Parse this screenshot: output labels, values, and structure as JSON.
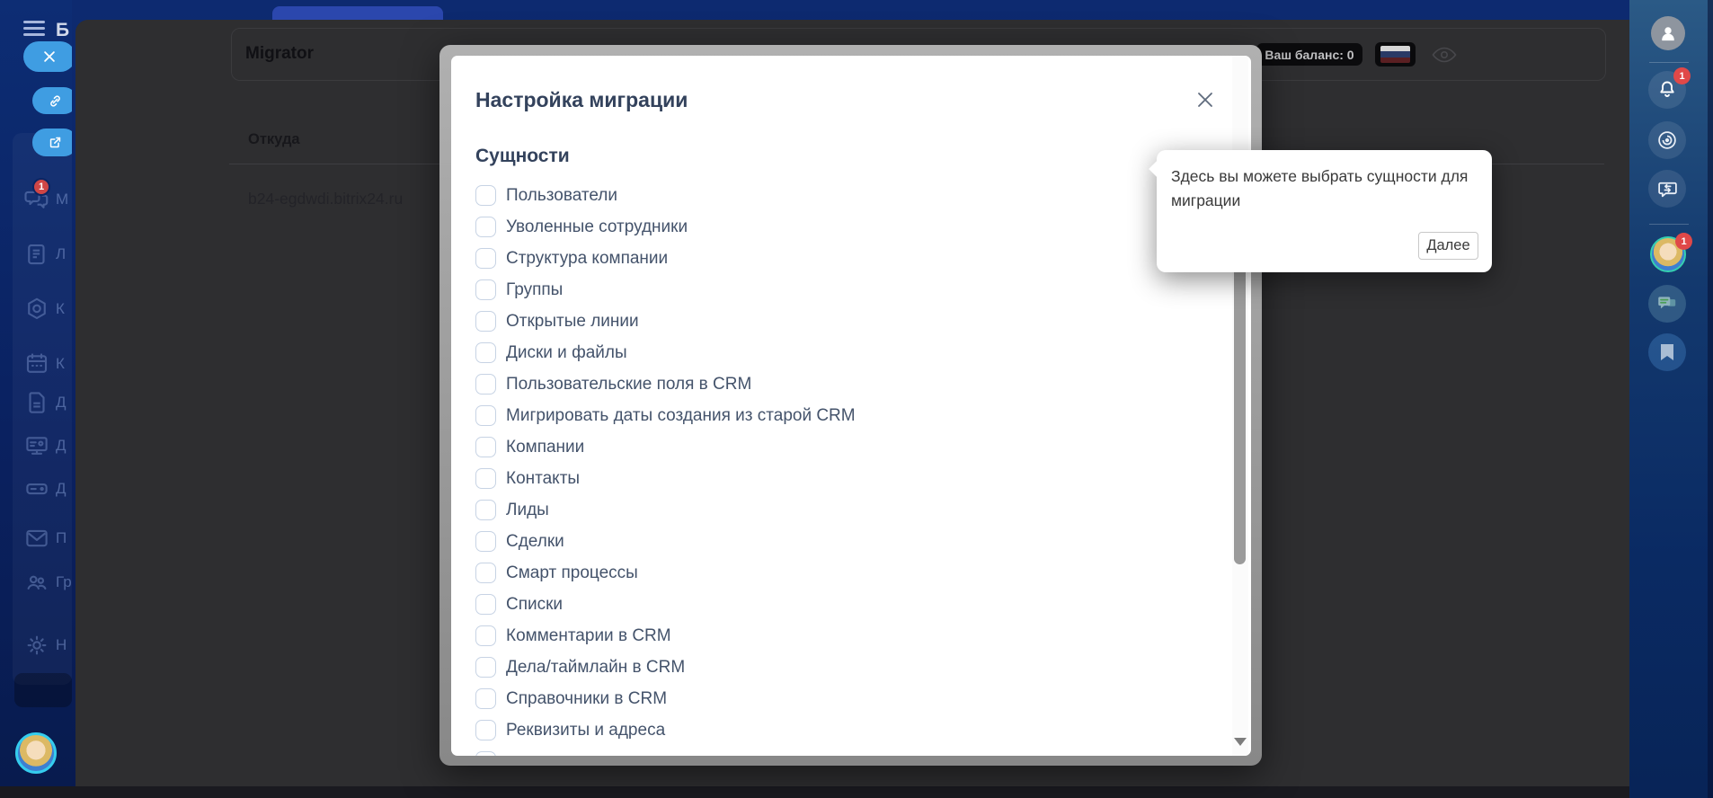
{
  "colors": {
    "accent_blue": "#3f9de2",
    "sidebar_navy": "#0a2363",
    "badge_red": "#e04848",
    "modal_title_text": "#33425c",
    "entity_label_text": "#44536b",
    "checkbox_border": "#c7d3e4",
    "overlay_dim": "#2e2e30"
  },
  "left_sidebar": {
    "hamburger_icon": "hamburger-icon",
    "logo_letter": "Б",
    "close_button_icon": "close-icon",
    "link_button_icon": "link-icon",
    "popout_button_icon": "external-link-icon",
    "menu": [
      {
        "icon": "messenger-icon",
        "label": "М",
        "badge": "1"
      },
      {
        "icon": "feed-icon",
        "label": "Л"
      },
      {
        "icon": "crm-icon",
        "label": "К"
      },
      {
        "icon": "calendar-icon",
        "label": "К"
      },
      {
        "icon": "docs-icon",
        "label": "Д"
      },
      {
        "icon": "boards-icon",
        "label": "Д"
      },
      {
        "icon": "drive-icon",
        "label": "Д"
      },
      {
        "icon": "mail-icon",
        "label": "П"
      },
      {
        "icon": "groups-icon",
        "label": "Гр"
      },
      {
        "icon": "settings-icon",
        "label": "Н"
      }
    ]
  },
  "workspace": {
    "app_title": "Migrator",
    "table": {
      "header": "Откуда",
      "rows": [
        "b24-egdwdi.bitrix24.ru"
      ]
    },
    "balance_badge": "Ваш баланс: 0",
    "flag_icon": "russia-flag-icon",
    "eye_icon": "eye-icon"
  },
  "modal": {
    "title": "Настройка миграции",
    "close_icon": "close-icon",
    "section_title": "Сущности",
    "entities": [
      {
        "label": "Пользователи",
        "checked": false
      },
      {
        "label": "Уволенные сотрудники",
        "checked": false
      },
      {
        "label": "Структура компании",
        "checked": false
      },
      {
        "label": "Группы",
        "checked": false
      },
      {
        "label": "Открытые линии",
        "checked": false
      },
      {
        "label": "Диски и файлы",
        "checked": false
      },
      {
        "label": "Пользовательские поля в CRM",
        "checked": false
      },
      {
        "label": "Мигрировать даты создания из старой CRM",
        "checked": false
      },
      {
        "label": "Компании",
        "checked": false
      },
      {
        "label": "Контакты",
        "checked": false
      },
      {
        "label": "Лиды",
        "checked": false
      },
      {
        "label": "Сделки",
        "checked": false
      },
      {
        "label": "Смарт процессы",
        "checked": false
      },
      {
        "label": "Списки",
        "checked": false
      },
      {
        "label": "Комментарии в CRM",
        "checked": false
      },
      {
        "label": "Дела/таймлайн в CRM",
        "checked": false
      },
      {
        "label": "Справочники в CRM",
        "checked": false
      },
      {
        "label": "Реквизиты и адреса",
        "checked": false
      },
      {
        "label": "",
        "checked": false
      }
    ]
  },
  "tooltip": {
    "text": "Здесь вы можете выбрать сущности для миграции",
    "button_label": "Далее"
  },
  "right_sidebar": {
    "items": [
      {
        "icon": "profile-avatar-icon"
      },
      {
        "icon": "notifications-bell-icon",
        "badge": "1"
      },
      {
        "icon": "copilot-icon"
      },
      {
        "icon": "chat-transfer-icon"
      },
      {
        "icon": "user-avatar",
        "badge": "1"
      },
      {
        "icon": "messenger-chat-icon"
      },
      {
        "icon": "bookmark-icon"
      }
    ]
  }
}
